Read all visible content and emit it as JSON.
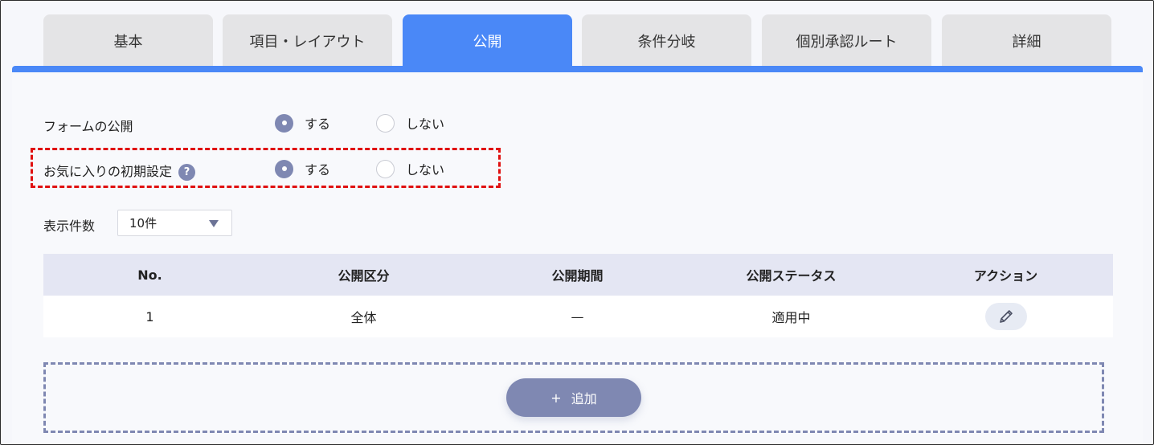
{
  "tabs": [
    {
      "label": "基本"
    },
    {
      "label": "項目・レイアウト"
    },
    {
      "label": "公開"
    },
    {
      "label": "条件分岐"
    },
    {
      "label": "個別承認ルート"
    },
    {
      "label": "詳細"
    }
  ],
  "active_tab": "公開",
  "form_publish": {
    "label": "フォームの公開",
    "yes": "する",
    "no": "しない",
    "selected": "する"
  },
  "favorite_default": {
    "label": "お気に入りの初期設定",
    "help": "?",
    "yes": "する",
    "no": "しない",
    "selected": "する"
  },
  "page_size": {
    "label": "表示件数",
    "value": "10件"
  },
  "table": {
    "headers": [
      "No.",
      "公開区分",
      "公開期間",
      "公開ステータス",
      "アクション"
    ],
    "rows": [
      {
        "no": "1",
        "scope": "全体",
        "period": "—",
        "status": "適用中"
      }
    ]
  },
  "add_button": {
    "plus": "+",
    "label": "追加"
  },
  "colors": {
    "accent": "#4a88f7",
    "radio_checked": "#7f88b2",
    "highlight": "#e01010"
  }
}
